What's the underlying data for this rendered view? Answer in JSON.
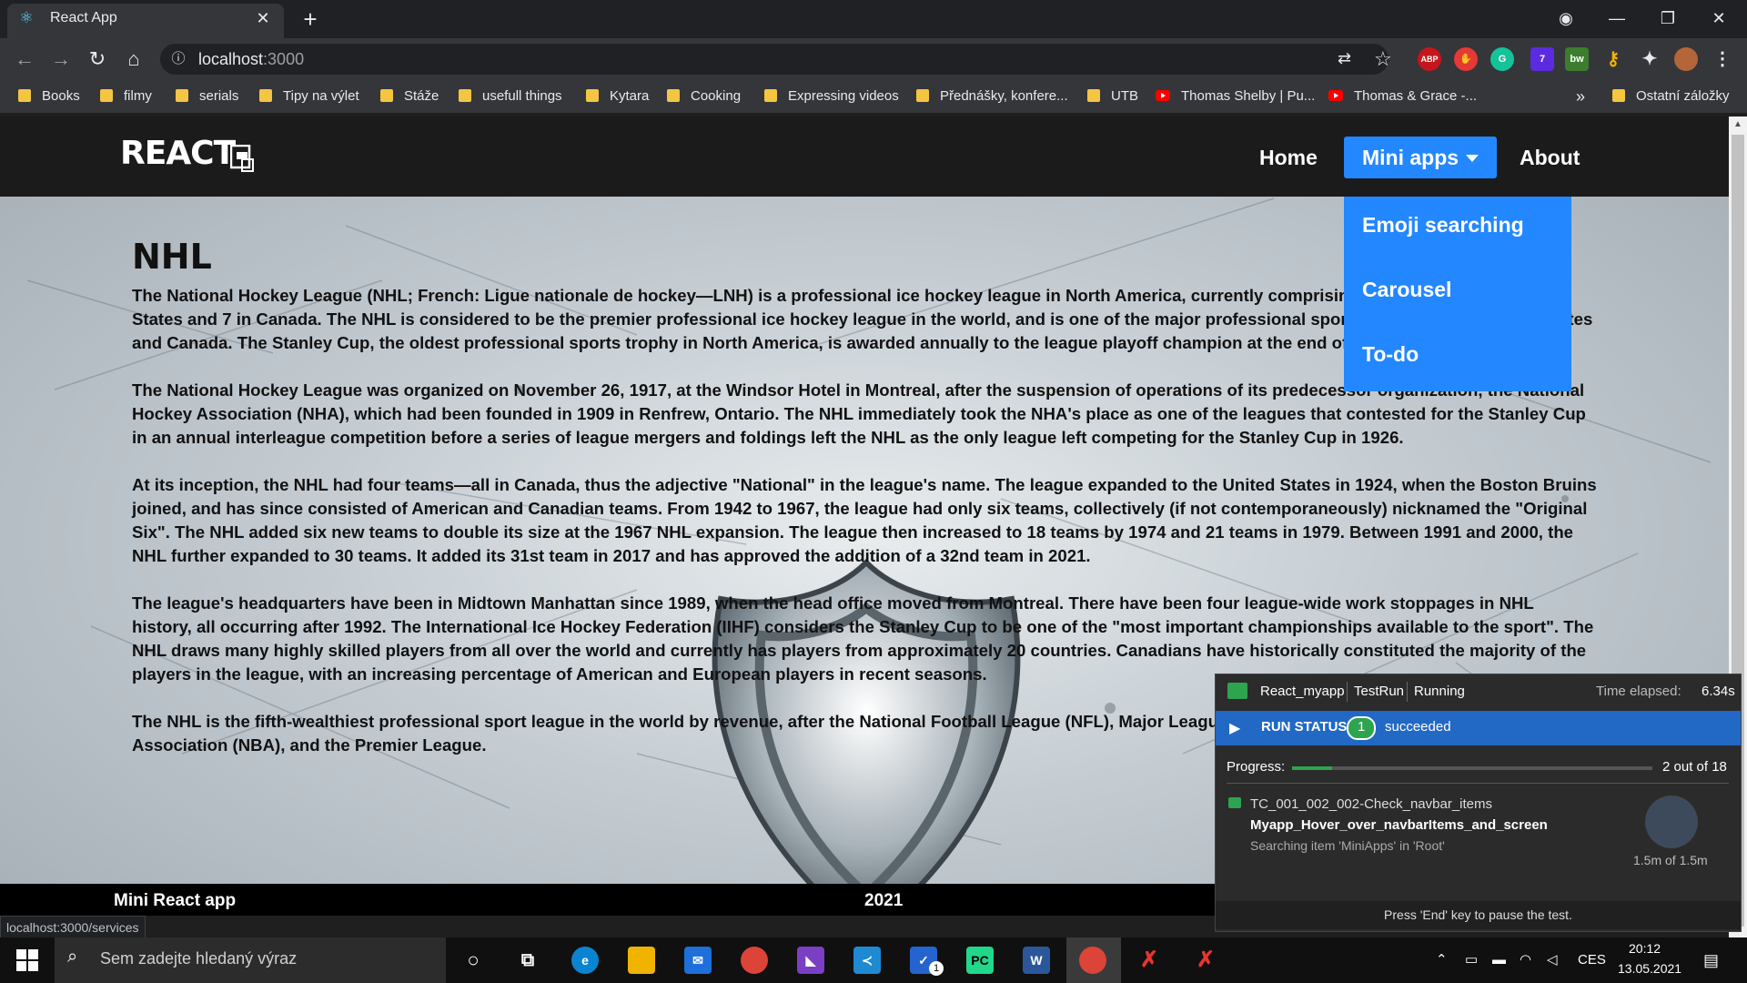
{
  "browser": {
    "tab_title": "React App",
    "url_host": "localhost",
    "url_port": ":3000",
    "bookmarks": [
      "Books",
      "filmy",
      "serials",
      "Tipy na výlet",
      "Stáže",
      "usefull things",
      "Kytara",
      "Cooking",
      "Expressing videos",
      "Přednášky, konfere...",
      "UTB"
    ],
    "yt_bookmarks": [
      "Thomas Shelby | Pu...",
      "Thomas & Grace -..."
    ],
    "more": "»",
    "other_bookmarks": "Ostatní záložky",
    "status_url": "localhost:3000/services",
    "extensions": [
      "ABP",
      "7"
    ]
  },
  "navbar": {
    "brand": "REACT",
    "home": "Home",
    "mini_apps": "Mini apps",
    "about": "About",
    "dropdown": [
      "Emoji searching",
      "Carousel",
      "To-do"
    ]
  },
  "content": {
    "title": "NHL",
    "paragraphs": [
      "The National Hockey League (NHL; French: Ligue nationale de hockey—LNH) is a professional ice hockey league in North America, currently comprising 31 teams: 24 in the United States and 7 in Canada. The NHL is considered to be the premier professional ice hockey league in the world, and is one of the major professional sports leagues in the United States and Canada. The Stanley Cup, the oldest professional sports trophy in North America, is awarded annually to the league playoff champion at the end of each season.",
      "The National Hockey League was organized on November 26, 1917, at the Windsor Hotel in Montreal, after the suspension of operations of its predecessor organization, the National Hockey Association (NHA), which had been founded in 1909 in Renfrew, Ontario. The NHL immediately took the NHA's place as one of the leagues that contested for the Stanley Cup in an annual interleague competition before a series of league mergers and foldings left the NHL as the only league left competing for the Stanley Cup in 1926.",
      "At its inception, the NHL had four teams—all in Canada, thus the adjective \"National\" in the league's name. The league expanded to the United States in 1924, when the Boston Bruins joined, and has since consisted of American and Canadian teams. From 1942 to 1967, the league had only six teams, collectively (if not contemporaneously) nicknamed the \"Original Six\". The NHL added six new teams to double its size at the 1967 NHL expansion. The league then increased to 18 teams by 1974 and 21 teams in 1979. Between 1991 and 2000, the NHL further expanded to 30 teams. It added its 31st team in 2017 and has approved the addition of a 32nd team in 2021.",
      "The league's headquarters have been in Midtown Manhattan since 1989, when the head office moved from Montreal. There have been four league-wide work stoppages in NHL history, all occurring after 1992. The International Ice Hockey Federation (IIHF) considers the Stanley Cup to be one of the \"most important championships available to the sport\". The NHL draws many highly skilled players from all over the world and currently has players from approximately 20 countries. Canadians have historically constituted the majority of the players in the league, with an increasing percentage of American and European players in recent seasons.",
      "The NHL is the fifth-wealthiest professional sport league in the world by revenue, after the National Football League (NFL), Major League Baseball (MLB), the National Basketball Association (NBA), and the Premier League."
    ]
  },
  "footer": {
    "left": "Mini React app",
    "middle": "2021"
  },
  "runner": {
    "project": "React_myapp",
    "run": "TestRun",
    "state": "Running",
    "elapsed_label": "Time elapsed:",
    "elapsed": "6.34s",
    "status_label": "RUN STATUS",
    "succeeded_count": "1",
    "succeeded_label": "succeeded",
    "progress_label": "Progress:",
    "progress_text": "2 out of 18",
    "progress_fraction": 0.111,
    "test_case": "TC_001_002_002-Check_navbar_items",
    "step": "Myapp_Hover_over_navbarItems_and_screen",
    "action": "Searching item 'MiniApps' in 'Root'",
    "timer": "1.5m of 1.5m",
    "footer": "Press 'End' key to pause the test."
  },
  "taskbar": {
    "search_placeholder": "Sem zadejte hledaný výraz",
    "lang": "CES",
    "time": "20:12",
    "date": "13.05.2021",
    "badge": "1"
  }
}
